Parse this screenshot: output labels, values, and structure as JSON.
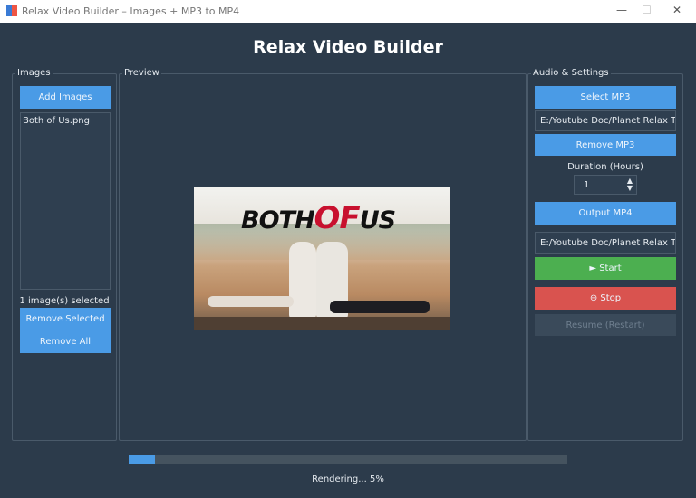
{
  "window": {
    "title": "Relax Video Builder – Images + MP3 to MP4",
    "minimize": "—",
    "maximize": "☐",
    "close": "✕"
  },
  "app_title": "Relax Video Builder",
  "images": {
    "label": "Images",
    "add_button": "Add Images",
    "files": [
      "Both of Us.png"
    ],
    "selection_status": "1 image(s) selected",
    "remove_selected": "Remove Selected",
    "remove_all": "Remove All"
  },
  "preview": {
    "label": "Preview",
    "image_text": [
      "BOTH",
      "OF",
      "US"
    ]
  },
  "audio": {
    "label": "Audio & Settings",
    "select_mp3": "Select MP3",
    "mp3_path": "E:/Youtube Doc/Planet Relax Time",
    "remove_mp3": "Remove MP3",
    "duration_label": "Duration (Hours)",
    "duration_value": "1",
    "output_mp4": "Output MP4",
    "output_path": "E:/Youtube Doc/Planet Relax Time",
    "start": "► Start",
    "stop": "⊖ Stop",
    "resume": "Resume (Restart)"
  },
  "progress": {
    "percent": 5,
    "status": "Rendering... 5%"
  },
  "colors": {
    "accent": "#4a9be6",
    "start": "#4caf50",
    "stop": "#d9534f",
    "disabled": "#3a4a5a"
  }
}
